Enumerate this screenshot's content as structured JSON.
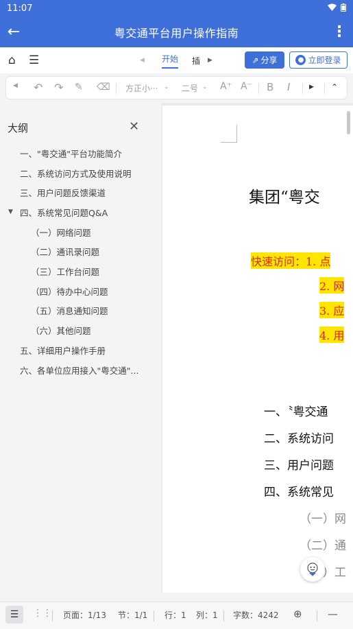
{
  "status": {
    "time": "11:07"
  },
  "appbar": {
    "title": "粤交通平台用户操作指南"
  },
  "tabs": {
    "start": "开始",
    "insert": "插",
    "share": "分享",
    "login": "立即登录"
  },
  "toolbar": {
    "font": "方正小···",
    "size": "二号"
  },
  "outline": {
    "title": "大纲",
    "items": [
      "一、\"粤交通\"平台功能简介",
      "二、系统访问方式及使用说明",
      "三、用户问题反馈渠道",
      "四、系统常见问题Q&A",
      "（一）网络问题",
      "（二）通讯录问题",
      "（三）工作台问题",
      "（四）待办中心问题",
      "（五）消息通知问题",
      "（六）其他问题",
      "五、详细用户操作手册",
      "六、各单位应用接入\"粤交通\"..."
    ]
  },
  "doc": {
    "title": "集团“粤交",
    "quick": [
      "快速访问：1. 点",
      "2. 网",
      "3. 应",
      "4. 用"
    ],
    "toc": [
      "一、〝粤交通",
      "二、系统访问",
      "三、用户问题",
      "四、系统常见"
    ],
    "sub": [
      "（一）网",
      "（二）通",
      "（三）工"
    ]
  },
  "footer": {
    "page": "页面：1/13",
    "section": "节：1/1",
    "row": "行：1",
    "col": "列：1",
    "words": "字数：4242"
  },
  "colors": {
    "primary": "#3f6fd8",
    "highlight": "#ffe600",
    "quick_text": "#e0261b"
  }
}
